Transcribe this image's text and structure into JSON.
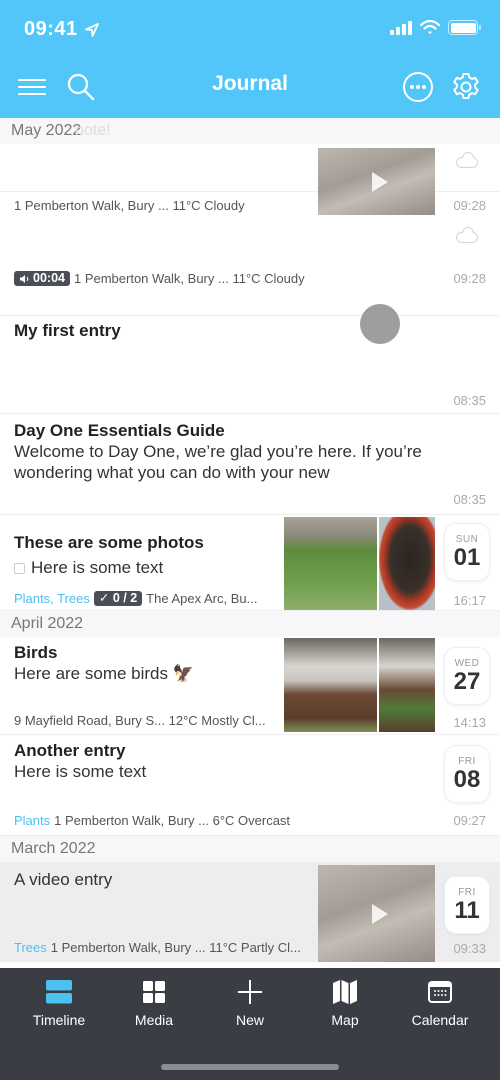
{
  "status_bar": {
    "time": "09:41",
    "location_icon": "location-arrow-icon",
    "signal_icon": "cellular-signal-icon",
    "wifi_icon": "wifi-icon",
    "battery_icon": "battery-icon",
    "battery_level": 1.0
  },
  "header": {
    "title": "Journal",
    "menu_icon": "hamburger-menu-icon",
    "search_icon": "search-icon",
    "more_icon": "more-ellipsis-icon",
    "settings_icon": "gear-icon"
  },
  "colors": {
    "brand": "#52c6f8",
    "tag": "#4cc1f0",
    "tabbar": "#3a3d43",
    "tab_active": "#4cc1f0"
  },
  "sections": [
    {
      "label": "May 2022",
      "ghost_text": "note!",
      "entries": [
        {
          "meta": "1 Pemberton Walk, Bury ... 11°C Cloudy",
          "time": "09:28",
          "weather_icon": "cloud-icon",
          "has_video": true
        },
        {
          "audio_badge": "00:04",
          "audio_icon": "speaker-icon",
          "meta": "1 Pemberton Walk, Bury ... 11°C Cloudy",
          "time": "09:28",
          "weather_icon": "cloud-icon"
        },
        {
          "title": "My first entry",
          "time": "08:35"
        },
        {
          "title": "Day One Essentials Guide",
          "body": "Welcome to Day One, we’re glad you’re here. If you’re wondering what you can do with your new",
          "time": "08:35"
        },
        {
          "title": "These are some photos",
          "body": "Here is some text",
          "tags": "Plants, Trees",
          "checklist_badge": "✓ 0 / 2",
          "meta": "The Apex Arc, Bu...",
          "dow": "SUN",
          "day": "01",
          "time": "16:17"
        }
      ]
    },
    {
      "label": "April 2022",
      "entries": [
        {
          "title": "Birds",
          "body": "Here are some birds 🦅",
          "meta": "9 Mayfield Road, Bury S... 12°C Mostly Cl...",
          "dow": "WED",
          "day": "27",
          "time": "14:13"
        },
        {
          "title": "Another entry",
          "body": "Here is some text",
          "tags": "Plants",
          "meta": "1 Pemberton Walk, Bury ... 6°C Overcast",
          "dow": "FRI",
          "day": "08",
          "time": "09:27"
        }
      ]
    },
    {
      "label": "March 2022",
      "entries": [
        {
          "body": "A video entry",
          "tags": "Trees",
          "meta": "1 Pemberton Walk, Bury ... 11°C Partly Cl...",
          "dow": "FRI",
          "day": "11",
          "time": "09:33",
          "has_video": true,
          "selected": true
        }
      ]
    }
  ],
  "tabbar": {
    "tabs": [
      {
        "label": "Timeline",
        "icon": "timeline-icon",
        "active": true
      },
      {
        "label": "Media",
        "icon": "media-grid-icon"
      },
      {
        "label": "New",
        "icon": "plus-icon"
      },
      {
        "label": "Map",
        "icon": "map-icon"
      },
      {
        "label": "Calendar",
        "icon": "calendar-icon"
      }
    ]
  }
}
